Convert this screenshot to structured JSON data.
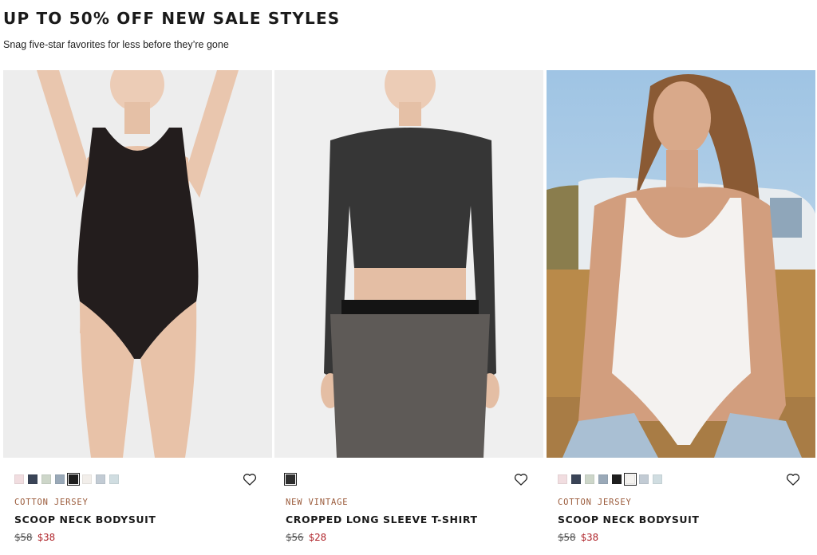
{
  "header": {
    "title": "UP TO 50% OFF NEW SALE STYLES",
    "subtitle": "Snag five-star favorites for less before they’re gone"
  },
  "products": [
    {
      "collection": "COTTON JERSEY",
      "name": "SCOOP NECK BODYSUIT",
      "original_price": "$58",
      "sale_price": "$38",
      "swatches": [
        "#f1dde0",
        "#3a4457",
        "#cdd6c9",
        "#9aa9b8",
        "#1e1e1e",
        "#f2eeea",
        "#c2cbd4",
        "#d0dde1"
      ],
      "selected_swatch": 4,
      "image": "model-black-bodysuit"
    },
    {
      "collection": "NEW VINTAGE",
      "name": "CROPPED LONG SLEEVE T-SHIRT",
      "original_price": "$56",
      "sale_price": "$28",
      "swatches": [
        "#2e2e2e"
      ],
      "selected_swatch": 0,
      "image": "model-charcoal-crop-top"
    },
    {
      "collection": "COTTON JERSEY",
      "name": "SCOOP NECK BODYSUIT",
      "original_price": "$58",
      "sale_price": "$38",
      "swatches": [
        "#f1dde0",
        "#3a4457",
        "#cdd6c9",
        "#9aa9b8",
        "#1e1e1e",
        "#f5f3f0",
        "#c2cbd4",
        "#d0dde1"
      ],
      "selected_swatch": 5,
      "image": "model-white-bodysuit-outdoor"
    }
  ],
  "colors": {
    "sale": "#b0262c",
    "collection": "#9a5a3a"
  },
  "icons": {
    "favorite": "heart-outline-icon"
  }
}
